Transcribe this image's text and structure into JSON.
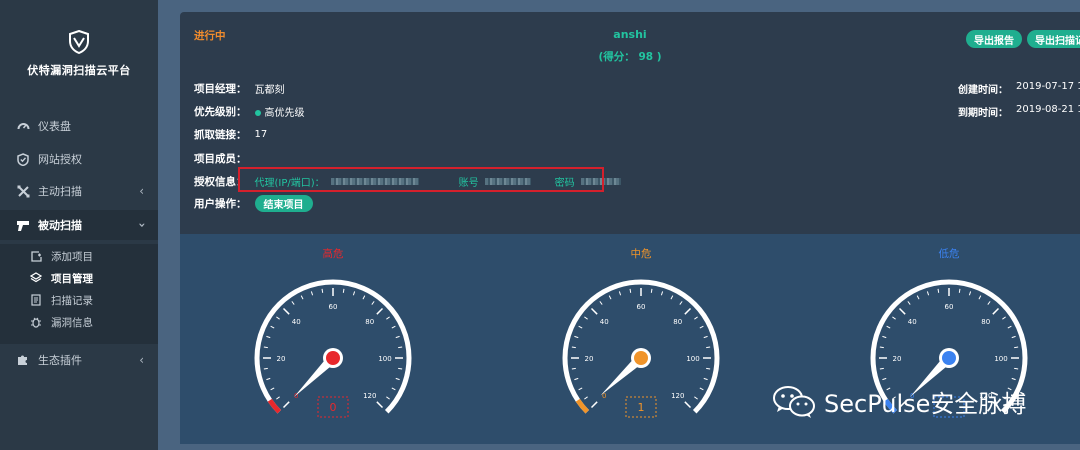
{
  "app": {
    "brand": "伏特漏洞扫描云平台"
  },
  "sidebar": {
    "items": [
      {
        "label": "仪表盘",
        "icon": "dashboard-icon"
      },
      {
        "label": "网站授权",
        "icon": "shield-icon"
      },
      {
        "label": "主动扫描",
        "icon": "crosshair-icon"
      },
      {
        "label": "被动扫描",
        "icon": "scan-gun-icon"
      },
      {
        "label": "生态插件",
        "icon": "puzzle-icon"
      }
    ],
    "subitems": [
      {
        "label": "添加项目",
        "icon": "add-icon"
      },
      {
        "label": "项目管理",
        "icon": "layers-icon"
      },
      {
        "label": "扫描记录",
        "icon": "document-icon"
      },
      {
        "label": "漏洞信息",
        "icon": "bug-icon"
      }
    ]
  },
  "project": {
    "status": "进行中",
    "name": "anshi",
    "score_text": "(得分： 98 )",
    "export_report": "导出报告",
    "export_scan": "导出扫描记",
    "manager_label": "项目经理：",
    "manager_value": "瓦都刻",
    "priority_label": "优先级别：",
    "priority_value": "高优先级",
    "links_label": "抓取链接：",
    "links_value": "17",
    "members_label": "项目成员：",
    "auth_label": "授权信息：",
    "proxy_label": "代理(IP/端口)：",
    "account_label": "账号",
    "password_label": "密码",
    "user_ops_label": "用户操作：",
    "end_project": "结束项目",
    "created_label": "创建时间：",
    "created_value": "2019-07-17 10:2",
    "expire_label": "到期时间：",
    "expire_value": "2019-08-21 16:2"
  },
  "gauges": [
    {
      "title": "高危",
      "value": "0",
      "level": 0,
      "color": "#e8282c"
    },
    {
      "title": "中危",
      "value": "1",
      "level": 1,
      "color": "#f0942a"
    },
    {
      "title": "低危",
      "value": "",
      "level": 0,
      "color": "#3b82f0"
    }
  ],
  "gauge_ticks": [
    "0",
    "20",
    "40",
    "60",
    "80",
    "100",
    "120"
  ],
  "watermark": "SecPulse安全脉搏",
  "colors": {
    "accent": "#1fae8f",
    "status": "#f08b2d",
    "sidebar": "#2b3946"
  }
}
